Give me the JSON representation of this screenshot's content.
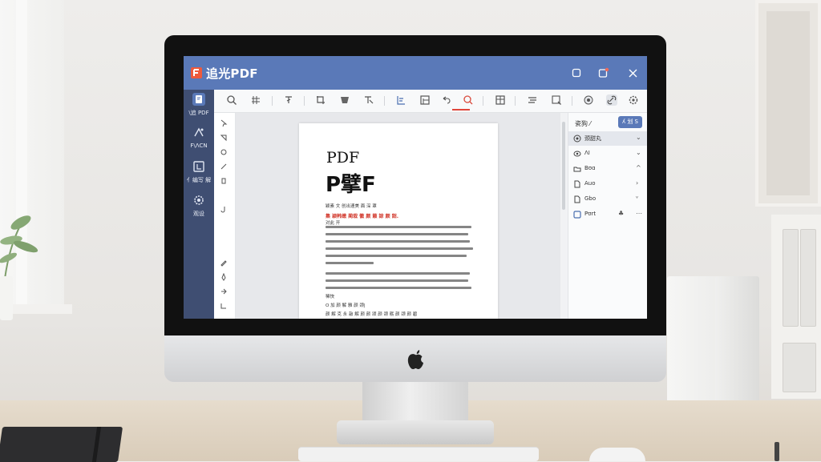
{
  "app": {
    "title": "追光PDF",
    "brand_color": "#5a79b8",
    "sidebar_color": "#3f4e72",
    "accent_red": "#e0463b"
  },
  "window_controls": [
    {
      "icon": "restore-icon"
    },
    {
      "icon": "notification-icon"
    },
    {
      "icon": "close-icon"
    }
  ],
  "sidebar": {
    "items": [
      {
        "label": "\\追 PDF",
        "icon": "pdf-file-icon",
        "active": true
      },
      {
        "label": "F\\ΛCN",
        "icon": "convert-icon"
      },
      {
        "label": "⺅编写 解",
        "icon": "edit-document-icon"
      },
      {
        "label": "观设",
        "icon": "settings-gear-icon"
      }
    ]
  },
  "toolbar": {
    "tools": [
      "search-icon",
      "grid-icon",
      "text-cursor-icon",
      "crop-icon",
      "stamp-icon",
      "pointer-icon",
      "align-left-icon",
      "page-icon",
      "undo-icon",
      "zoom-icon",
      "book-icon",
      "list-icon",
      "find-icon",
      "cloud-icon",
      "link-icon",
      "gear-icon"
    ]
  },
  "document": {
    "heading_latin": "PDF",
    "heading_cjk": "P擘F",
    "meta_line1": "颖素 文 创出速美 面 深 罩",
    "red_line": "集 颖韩嫩 蔺栽 徽 颜 籁 諒 颜 韶.",
    "meta_line2": "对此 开",
    "meta_line3": "稀快",
    "meta_line4": "O 加 颜 解 雅 颜 颈|",
    "meta_line5": "颜  解 克  永 敲 解 颜  颜 颂 颜 颈 粝 颜 颈  颜  碧"
  },
  "right_panel": {
    "title": "瓷狗 ⁄",
    "button": "ʎ 划 S",
    "rows": [
      {
        "icon": "circle-dot-icon",
        "label": "颈甜丸",
        "chevron": "⌄",
        "selected": true
      },
      {
        "icon": "eye-icon",
        "label": "ΛI",
        "chevron": "⌄"
      },
      {
        "icon": "folder-icon",
        "label": "Bʊɑ",
        "chevron": "^"
      },
      {
        "icon": "file-icon",
        "label": "Auo",
        "chevron": "›"
      },
      {
        "icon": "file-icon",
        "label": "Gbo",
        "chevron": "ᵛ"
      },
      {
        "icon": "checkbox-icon",
        "label": "Pʊrt",
        "chevron": "⋯",
        "extra": "♣"
      }
    ]
  }
}
